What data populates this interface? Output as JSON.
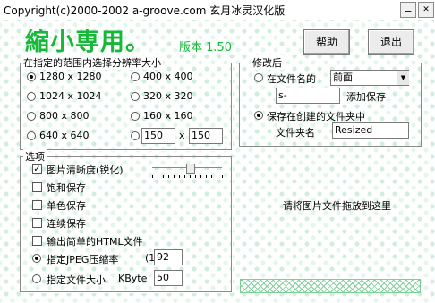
{
  "window": {
    "title": "Copyright(c)2000-2002 a-groove.com 玄月冰灵汉化版"
  },
  "brand": {
    "name": "縮小専用。",
    "version": "版本 1.50"
  },
  "buttons": {
    "help": "帮助",
    "exit": "退出"
  },
  "resolution": {
    "legend": "在指定的范围内选择分辨率大小",
    "options": [
      "1280 x 1280",
      "400 x 400",
      "1024 x 1024",
      "320 x 320",
      "800 x 800",
      "160 x 160",
      "640 x 640"
    ],
    "custom_w": "150",
    "custom_sep": "x",
    "custom_h": "150",
    "selected": "1280 x 1280"
  },
  "modify": {
    "legend": "修改后",
    "rename_label": "在文件名的",
    "position_value": "前面",
    "suffix_value": "s-",
    "add_save": "添加保存",
    "folder_option": "保存在创建的文件夹中",
    "folder_name_label": "文件夹名",
    "folder_name_value": "Resized",
    "selected": "folder"
  },
  "options": {
    "legend": "选项",
    "sharpen": {
      "label": "图片清晰度(锐化)",
      "checked": true,
      "level": 0.5
    },
    "saturation": {
      "label": "饱和保存",
      "checked": false
    },
    "mono": {
      "label": "单色保存",
      "checked": false
    },
    "continuous": {
      "label": "连续保存",
      "checked": false
    },
    "html": {
      "label": "输出简单的HTML文件",
      "checked": false
    },
    "jpeg": {
      "label": "指定JPEG压缩率",
      "hint": "(1",
      "value": "92"
    },
    "filesize": {
      "label": "指定文件大小",
      "unit": "KByte",
      "value": "50"
    },
    "selected": "jpeg"
  },
  "drop_hint": "请将图片文件拖放到这里",
  "colors": {
    "brand": "#17b83a",
    "pattern": "#cfeedd"
  },
  "icons": {
    "minimize": "minimize-icon",
    "close": "close-icon"
  }
}
